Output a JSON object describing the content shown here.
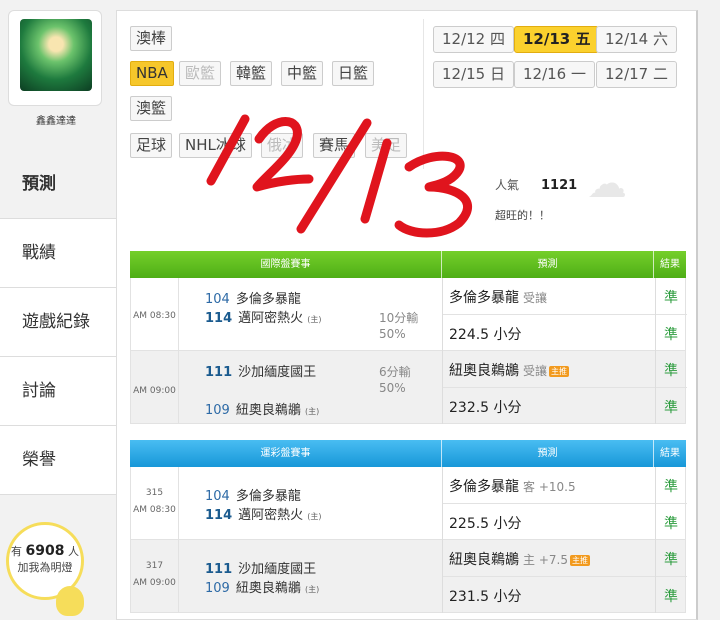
{
  "profile": {
    "name": "鑫鑫達達"
  },
  "menu": [
    {
      "label": "預測"
    },
    {
      "label": "戰績"
    },
    {
      "label": "遊戲紀錄"
    },
    {
      "label": "討論"
    },
    {
      "label": "榮譽"
    }
  ],
  "fans": {
    "prefix": "有",
    "count": "6908",
    "suffix": "人",
    "cta": "加我為明燈"
  },
  "sports": {
    "row1": [
      "澳棒"
    ],
    "row2": [
      "NBA",
      "歐籃",
      "韓籃",
      "中籃",
      "日籃"
    ],
    "row3": [
      "澳籃"
    ],
    "row4": [
      "足球",
      "NHL冰球",
      "俄冰",
      "賽馬",
      "美足"
    ]
  },
  "dates": {
    "row1": [
      {
        "md": "12/12",
        "wd": "四"
      },
      {
        "md": "12/13",
        "wd": "五"
      },
      {
        "md": "12/14",
        "wd": "六"
      }
    ],
    "row2": [
      {
        "md": "12/15",
        "wd": "日"
      },
      {
        "md": "12/16",
        "wd": "一"
      },
      {
        "md": "12/17",
        "wd": "二"
      }
    ]
  },
  "popularity": {
    "label": "人氣",
    "value": "1121",
    "status": "超旺的！！"
  },
  "overlay_text": "12/13",
  "table1": {
    "headers": [
      "國際盤賽事",
      "預測",
      "結果"
    ],
    "games": [
      {
        "time": "AM 08:30",
        "away": {
          "num": "104",
          "name": "多倫多暴龍"
        },
        "home": {
          "num": "114",
          "name": "邁阿密熱火",
          "tag": "(主)"
        },
        "spread": "10分輸",
        "pct": "50%",
        "pick1": {
          "text": "多倫多暴龍",
          "sub": "受讓",
          "star": ""
        },
        "pick2": {
          "text": "224.5 小分"
        },
        "res1": "準",
        "res2": "準"
      },
      {
        "time": "AM 09:00",
        "away": {
          "num": "111",
          "name": "沙加緬度國王"
        },
        "home": {
          "num": "109",
          "name": "紐奧良鵜鶘",
          "tag": "(主)"
        },
        "spread": "6分輸",
        "pct": "50%",
        "pick1": {
          "text": "紐奧良鵜鶘",
          "sub": "受讓",
          "star": "主推"
        },
        "pick2": {
          "text": "232.5 小分"
        },
        "res1": "準",
        "res2": "準"
      }
    ]
  },
  "table2": {
    "headers": [
      "運彩盤賽事",
      "預測",
      "結果"
    ],
    "games": [
      {
        "id": "315",
        "time": "AM 08:30",
        "away": {
          "num": "104",
          "name": "多倫多暴龍"
        },
        "home": {
          "num": "114",
          "name": "邁阿密熱火",
          "tag": "(主)"
        },
        "pick1": {
          "text": "多倫多暴龍",
          "sub": "客 +10.5",
          "star": ""
        },
        "pick2": {
          "text": "225.5 小分"
        },
        "res1": "準",
        "res2": "準"
      },
      {
        "id": "317",
        "time": "AM 09:00",
        "away": {
          "num": "111",
          "name": "沙加緬度國王"
        },
        "home": {
          "num": "109",
          "name": "紐奧良鵜鶘",
          "tag": "(主)"
        },
        "pick1": {
          "text": "紐奧良鵜鶘",
          "sub": "主 +7.5",
          "star": "主推"
        },
        "pick2": {
          "text": "231.5 小分"
        },
        "res1": "準",
        "res2": "準"
      }
    ]
  },
  "colors": {
    "accent_yellow": "#fbd12d",
    "green_header": "#5cbd1e",
    "blue_header": "#2aa8e6",
    "result_green": "#2c9c3e",
    "scrawl_red": "#e0141d"
  }
}
